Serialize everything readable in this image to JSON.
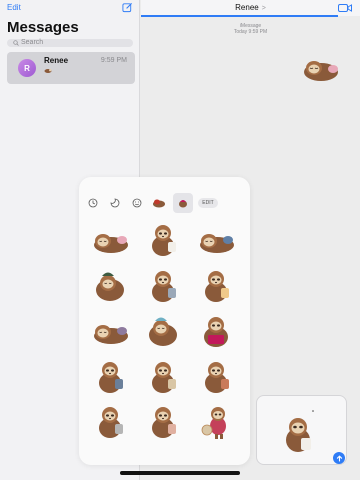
{
  "sidebar": {
    "edit_label": "Edit",
    "title": "Messages",
    "search_placeholder": "Search",
    "conversations": [
      {
        "avatar_initial": "R",
        "name": "Renee",
        "time": "9:59 PM",
        "preview_icon": "sloth-sticker-icon"
      }
    ]
  },
  "conversation": {
    "contact_name": "Renee",
    "contact_chevron": ">",
    "service_label": "iMessage",
    "timestamp": "Today 9:59 PM",
    "progress": 0.9
  },
  "drawer": {
    "tabs": [
      "recents-icon",
      "sticker-pack-icon",
      "emoji-icon",
      "sticker-app-1-icon",
      "sticker-app-2-icon"
    ],
    "selected_tab": 4,
    "edit_label": "EDIT",
    "sticker_count": 15
  },
  "colors": {
    "accent": "#2f7cf6",
    "avatar": "#b373dc",
    "fur": "#8a5a3a",
    "face": "#e9d2b2"
  }
}
